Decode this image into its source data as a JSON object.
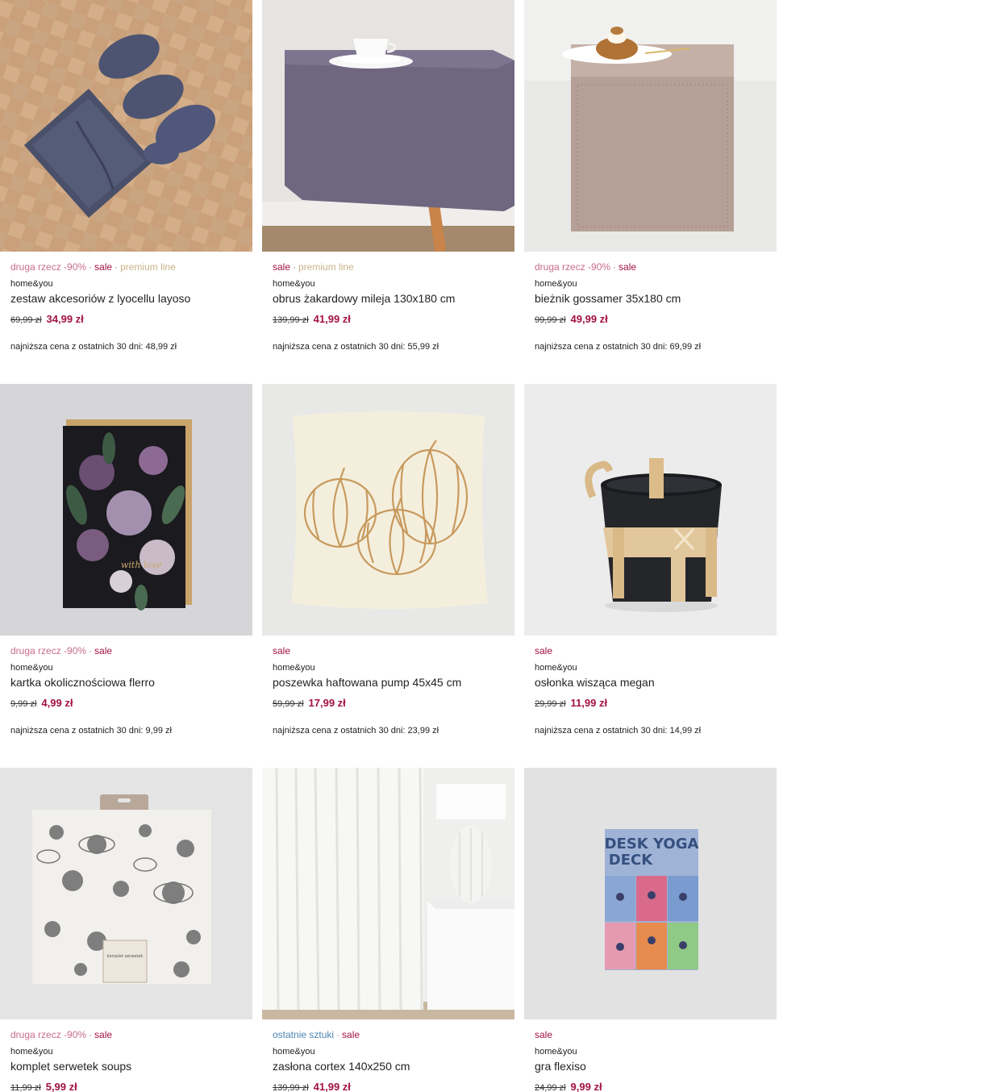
{
  "products": [
    {
      "tags": [
        {
          "text": "druga rzecz -90%",
          "kind": "promo"
        },
        {
          "text": "sale",
          "kind": "sale"
        },
        {
          "text": "premium line",
          "kind": "premium"
        }
      ],
      "brand": "home&you",
      "name": "zestaw akcesoriów z lyocellu layoso",
      "old_price": "69,99 zł",
      "new_price": "34,99 zł",
      "lowest": "najniższa cena z ostatnich 30 dni: 48,99 zł",
      "image": "sleep-set-image"
    },
    {
      "tags": [
        {
          "text": "sale",
          "kind": "sale"
        },
        {
          "text": "premium line",
          "kind": "premium"
        }
      ],
      "brand": "home&you",
      "name": "obrus żakardowy mileja 130x180 cm",
      "old_price": "139,99 zł",
      "new_price": "41,99 zł",
      "lowest": "najniższa cena z ostatnich 30 dni: 55,99 zł",
      "image": "tablecloth-image"
    },
    {
      "tags": [
        {
          "text": "druga rzecz -90%",
          "kind": "promo"
        },
        {
          "text": "sale",
          "kind": "sale"
        }
      ],
      "brand": "home&you",
      "name": "bieżnik gossamer 35x180 cm",
      "old_price": "99,99 zł",
      "new_price": "49,99 zł",
      "lowest": "najniższa cena z ostatnich 30 dni: 69,99 zł",
      "image": "table-runner-image"
    },
    {
      "tags": [
        {
          "text": "druga rzecz -90%",
          "kind": "promo"
        },
        {
          "text": "sale",
          "kind": "sale"
        }
      ],
      "brand": "home&you",
      "name": "kartka okolicznościowa flerro",
      "old_price": "9,99 zł",
      "new_price": "4,99 zł",
      "lowest": "najniższa cena z ostatnich 30 dni: 9,99 zł",
      "image": "greeting-card-image",
      "image_text": "with love"
    },
    {
      "tags": [
        {
          "text": "sale",
          "kind": "sale"
        }
      ],
      "brand": "home&you",
      "name": "poszewka haftowana pump 45x45 cm",
      "old_price": "59,99 zł",
      "new_price": "17,99 zł",
      "lowest": "najniższa cena z ostatnich 30 dni: 23,99 zł",
      "image": "pillowcase-image"
    },
    {
      "tags": [
        {
          "text": "sale",
          "kind": "sale"
        }
      ],
      "brand": "home&you",
      "name": "osłonka wisząca megan",
      "old_price": "29,99 zł",
      "new_price": "11,99 zł",
      "lowest": "najniższa cena z ostatnich 30 dni: 14,99 zł",
      "image": "hanging-pot-image"
    },
    {
      "tags": [
        {
          "text": "druga rzecz -90%",
          "kind": "promo"
        },
        {
          "text": "sale",
          "kind": "sale"
        }
      ],
      "brand": "home&you",
      "name": "komplet serwetek soups",
      "old_price": "11,99 zł",
      "new_price": "5,99 zł",
      "lowest": "",
      "image": "napkins-image",
      "image_text": "komplet serwetek"
    },
    {
      "tags": [
        {
          "text": "ostatnie sztuki",
          "kind": "last"
        },
        {
          "text": "sale",
          "kind": "sale"
        }
      ],
      "brand": "home&you",
      "name": "zasłona cortex 140x250 cm",
      "old_price": "139,99 zł",
      "new_price": "41,99 zł",
      "lowest": "",
      "image": "curtain-image"
    },
    {
      "tags": [
        {
          "text": "sale",
          "kind": "sale"
        }
      ],
      "brand": "home&you",
      "name": "gra flexiso",
      "old_price": "24,99 zł",
      "new_price": "9,99 zł",
      "lowest": "",
      "image": "card-game-image",
      "image_text": [
        "DESK YOGA",
        "DECK"
      ]
    }
  ],
  "colors": {
    "sale": "#a3123f",
    "promo": "#c96b8f",
    "premium": "#c9b48a",
    "last": "#4d86b3"
  }
}
